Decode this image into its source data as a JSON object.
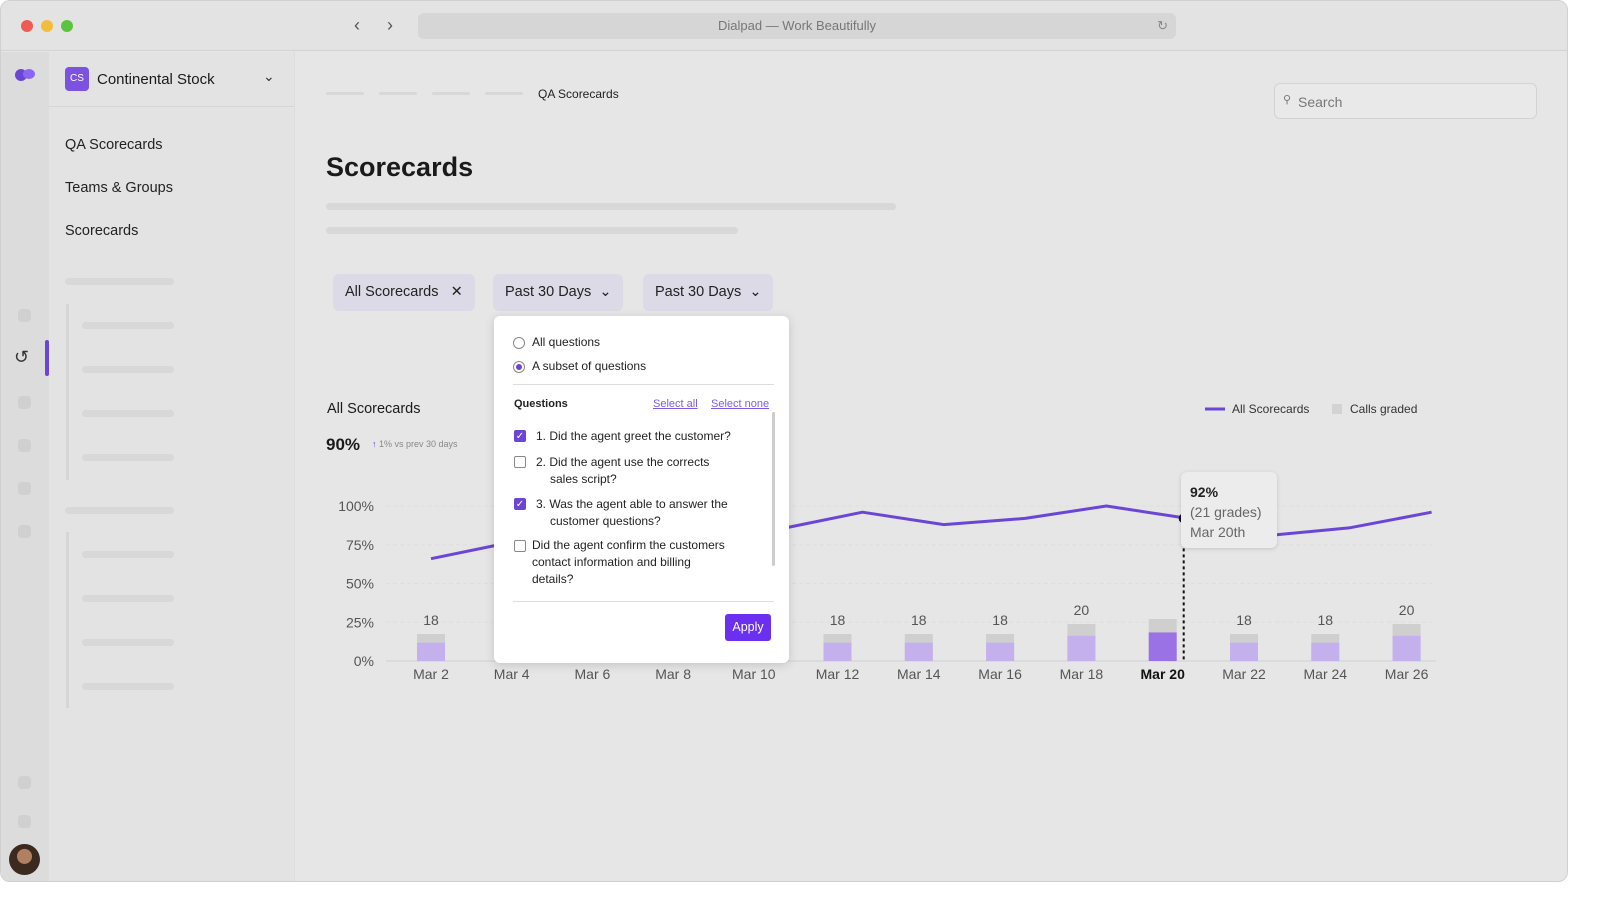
{
  "window": {
    "title": "Dialpad — Work Beautifully"
  },
  "colors": {
    "accent": "#6b46d6",
    "bar_gray": "#cfcfcf",
    "bar_purple": "#c4b0ec",
    "bar_highlight": "#9b72e6"
  },
  "sidebar": {
    "org_initials": "CS",
    "org_name": "Continental Stock",
    "items": [
      {
        "label": "QA Scorecards"
      },
      {
        "label": "Teams & Groups"
      },
      {
        "label": "Scorecards"
      }
    ]
  },
  "breadcrumb": {
    "current": "QA Scorecards"
  },
  "search": {
    "placeholder": "Search"
  },
  "page": {
    "title": "Scorecards"
  },
  "filters": {
    "scorecard": "All Scorecards",
    "range1": "Past 30 Days",
    "range2": "Past 30 Days"
  },
  "popup": {
    "radio_all": "All questions",
    "radio_subset": "A subset of questions",
    "selected_radio": "subset",
    "questions_label": "Questions",
    "select_all": "Select all",
    "select_none": "Select none",
    "questions": [
      {
        "line1": "1. Did the agent greet the customer?",
        "line2": "",
        "checked": true
      },
      {
        "line1": "2. Did the agent use the corrects",
        "line2": "sales script?",
        "checked": false
      },
      {
        "line1": "3. Was the agent able to answer the",
        "line2": "customer questions?",
        "checked": true
      },
      {
        "line1": "Did the agent confirm the customers",
        "line2": "contact information and billing",
        "line3": "details?",
        "checked": false
      }
    ],
    "apply": "Apply"
  },
  "chart_data": {
    "type": "bar+line",
    "title": "All Scorecards",
    "summary_value": "90%",
    "summary_change": "1% vs prev 30 days",
    "legend": [
      {
        "name": "All Scorecards",
        "kind": "line"
      },
      {
        "name": "Calls graded",
        "kind": "bar"
      }
    ],
    "legend_position": "top-right",
    "categories": [
      "Mar 2",
      "Mar 4",
      "Mar 6",
      "Mar 8",
      "Mar 10",
      "Mar 12",
      "Mar 14",
      "Mar 16",
      "Mar 18",
      "Mar 20",
      "Mar 22",
      "Mar 24",
      "Mar 26"
    ],
    "highlighted": "Mar 20",
    "y_ticks": [
      "100%",
      "75%",
      "50%",
      "25%",
      "0%"
    ],
    "ylim": [
      0,
      100
    ],
    "grid": true,
    "series": [
      {
        "name": "All Scorecards",
        "type": "line",
        "values": [
          66,
          80,
          null,
          null,
          85,
          96,
          88,
          92,
          100,
          92,
          81,
          86,
          96
        ]
      },
      {
        "name": "Calls graded",
        "type": "bar",
        "values": [
          18,
          null,
          null,
          null,
          null,
          18,
          18,
          18,
          20,
          21,
          18,
          18,
          20
        ],
        "labels": [
          "18",
          "",
          "",
          "",
          "",
          "18",
          "18",
          "18",
          "20",
          "",
          "18",
          "18",
          "20"
        ]
      }
    ],
    "tooltip": {
      "value": "92%",
      "grades": "(21 grades)",
      "date": "Mar 20th"
    }
  }
}
